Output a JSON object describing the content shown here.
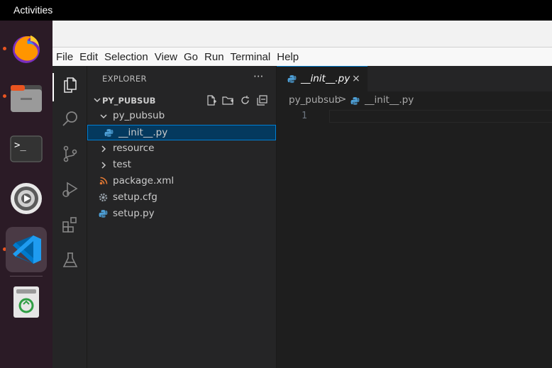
{
  "topbar": {
    "activities": "Activities"
  },
  "menu": [
    "File",
    "Edit",
    "Selection",
    "View",
    "Go",
    "Run",
    "Terminal",
    "Help"
  ],
  "explorer": {
    "header": "EXPLORER",
    "more": "···",
    "section": "PY_PUBSUB",
    "items": [
      {
        "label": "py_pubsub",
        "kind": "folder-open"
      },
      {
        "label": "__init__.py",
        "kind": "python"
      },
      {
        "label": "resource",
        "kind": "folder"
      },
      {
        "label": "test",
        "kind": "folder"
      },
      {
        "label": "package.xml",
        "kind": "rss"
      },
      {
        "label": "setup.cfg",
        "kind": "gear"
      },
      {
        "label": "setup.py",
        "kind": "python"
      }
    ]
  },
  "tab": {
    "label": "__init__.py",
    "close": "×"
  },
  "breadcrumb": {
    "folder": "py_pubsub",
    "sep": ">",
    "file": "__init__.py"
  },
  "editor": {
    "line_number": "1"
  },
  "colors": {
    "accent": "#007acc",
    "selection": "#04395e",
    "python": "#4d9fd6",
    "xml": "#e37933",
    "ubuntu_orange": "#e95420"
  },
  "icons": {
    "dock": [
      "firefox-icon",
      "files-icon",
      "terminal-icon",
      "settings-icon",
      "vscode-icon",
      "trash-icon"
    ],
    "activitybar": [
      "files-icon",
      "search-icon",
      "source-control-icon",
      "run-debug-icon",
      "extensions-icon",
      "testing-icon"
    ]
  }
}
